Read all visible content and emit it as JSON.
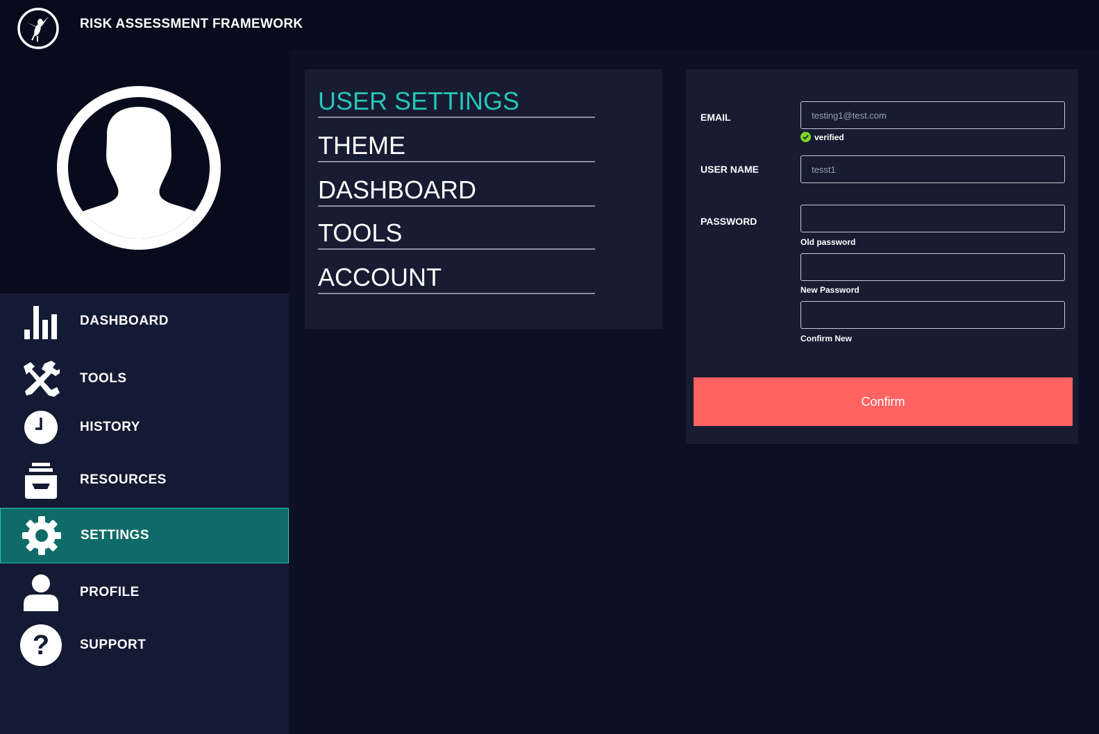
{
  "app": {
    "title": "RISK ASSESSMENT FRAMEWORK",
    "logo_icon": "wasp-logo-icon"
  },
  "sidebar": {
    "avatar_icon": "user-silhouette-icon",
    "items": [
      {
        "label": "DASHBOARD",
        "icon": "bar-chart-icon",
        "active": false
      },
      {
        "label": "TOOLS",
        "icon": "hammer-wrench-icon",
        "active": false
      },
      {
        "label": "HISTORY",
        "icon": "clock-icon",
        "active": false
      },
      {
        "label": "RESOURCES",
        "icon": "archive-box-icon",
        "active": false
      },
      {
        "label": "SETTINGS",
        "icon": "gear-icon",
        "active": true
      },
      {
        "label": "PROFILE",
        "icon": "person-icon",
        "active": false
      },
      {
        "label": "SUPPORT",
        "icon": "question-mark-icon",
        "active": false
      }
    ]
  },
  "settings_menu": {
    "items": [
      {
        "label": "USER SETTINGS",
        "active": true
      },
      {
        "label": "THEME",
        "active": false
      },
      {
        "label": "DASHBOARD",
        "active": false
      },
      {
        "label": "TOOLS",
        "active": false
      },
      {
        "label": "ACCOUNT",
        "active": false
      }
    ]
  },
  "form": {
    "email": {
      "label": "EMAIL",
      "placeholder": "testing1@test.com",
      "value": "",
      "status": "verified"
    },
    "username": {
      "label": "USER NAME",
      "placeholder": "tesst1",
      "value": ""
    },
    "password": {
      "label": "PASSWORD",
      "old_label": "Old password",
      "new_label": "New Password",
      "confirm_label": "Confirm New"
    },
    "confirm_button": "Confirm"
  },
  "colors": {
    "accent": "#26c6b8",
    "active_nav_bg": "#0e6b67",
    "confirm_bg": "#fe6361",
    "verified_green": "#7ed321"
  }
}
